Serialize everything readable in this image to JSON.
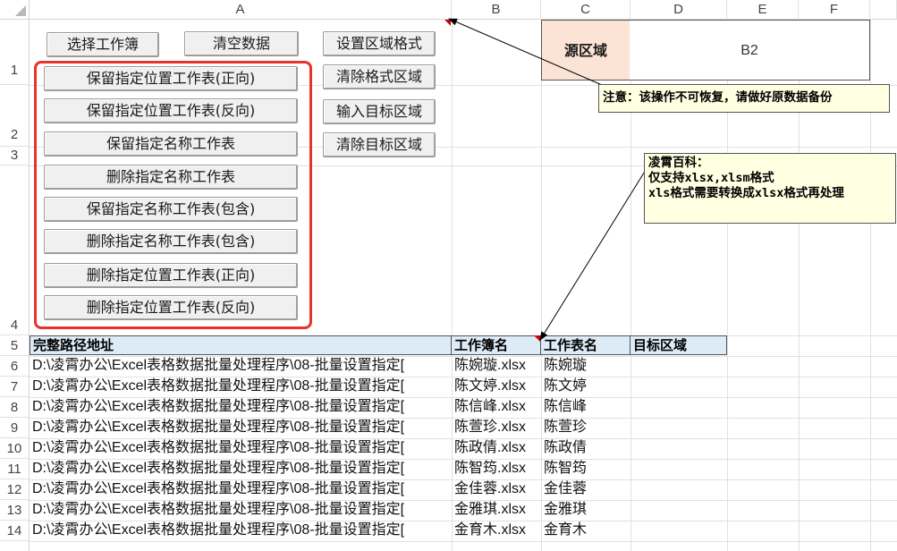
{
  "columns": [
    "A",
    "B",
    "C",
    "D",
    "E",
    "F"
  ],
  "rows": [
    "1",
    "2",
    "3",
    "4",
    "5",
    "6",
    "7",
    "8",
    "9",
    "10",
    "11",
    "12",
    "13",
    "14"
  ],
  "buttons": {
    "select_workbook": "选择工作簿",
    "clear_data": "清空数据",
    "set_region_format": "设置区域格式",
    "clear_format_region": "清除格式区域",
    "input_target_region": "输入目标区域",
    "clear_target_region": "清除目标区域",
    "keep_position_forward": "保留指定位置工作表(正向)",
    "keep_position_reverse": "保留指定位置工作表(反向)",
    "keep_name": "保留指定名称工作表",
    "delete_name": "删除指定名称工作表",
    "keep_name_contains": "保留指定名称工作表(包含)",
    "delete_name_contains": "删除指定名称工作表(包含)",
    "delete_position_forward": "删除指定位置工作表(正向)",
    "delete_position_reverse": "删除指定位置工作表(反向)"
  },
  "source_area": {
    "label": "源区域",
    "value": "B2"
  },
  "comments": {
    "warning": "注意：该操作不可恢复，请做好原数据备份",
    "info_line1": "凌霄百科：",
    "info_line2": "仅支持xlsx,xlsm格式",
    "info_line3": "xls格式需要转换成xlsx格式再处理"
  },
  "table": {
    "headers": [
      "完整路径地址",
      "工作簿名",
      "工作表名",
      "目标区域"
    ],
    "rows": [
      {
        "path": "D:\\凌霄办公\\Excel表格数据批量处理程序\\08-批量设置指定[",
        "workbook": "陈婉璇.xlsx",
        "sheet": "陈婉璇"
      },
      {
        "path": "D:\\凌霄办公\\Excel表格数据批量处理程序\\08-批量设置指定[",
        "workbook": "陈文婷.xlsx",
        "sheet": "陈文婷"
      },
      {
        "path": "D:\\凌霄办公\\Excel表格数据批量处理程序\\08-批量设置指定[",
        "workbook": "陈信峰.xlsx",
        "sheet": "陈信峰"
      },
      {
        "path": "D:\\凌霄办公\\Excel表格数据批量处理程序\\08-批量设置指定[",
        "workbook": "陈萱珍.xlsx",
        "sheet": "陈萱珍"
      },
      {
        "path": "D:\\凌霄办公\\Excel表格数据批量处理程序\\08-批量设置指定[",
        "workbook": "陈政倩.xlsx",
        "sheet": "陈政倩"
      },
      {
        "path": "D:\\凌霄办公\\Excel表格数据批量处理程序\\08-批量设置指定[",
        "workbook": "陈智筠.xlsx",
        "sheet": "陈智筠"
      },
      {
        "path": "D:\\凌霄办公\\Excel表格数据批量处理程序\\08-批量设置指定[",
        "workbook": "金佳蓉.xlsx",
        "sheet": "金佳蓉"
      },
      {
        "path": "D:\\凌霄办公\\Excel表格数据批量处理程序\\08-批量设置指定[",
        "workbook": "金雅琪.xlsx",
        "sheet": "金雅琪"
      },
      {
        "path": "D:\\凌霄办公\\Excel表格数据批量处理程序\\08-批量设置指定[",
        "workbook": "金育木.xlsx",
        "sheet": "金育木"
      }
    ]
  },
  "colors": {
    "header_fill": "#ddebf7",
    "source_fill": "#fbe3d6",
    "comment_fill": "#ffffe1",
    "frame_red": "#e8332c"
  }
}
